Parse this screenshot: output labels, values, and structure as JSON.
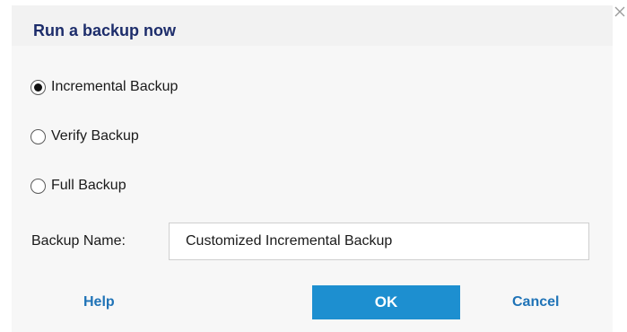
{
  "dialog": {
    "title": "Run a backup now",
    "close_icon": "close-icon"
  },
  "backup_types": [
    {
      "label": "Incremental Backup",
      "selected": true
    },
    {
      "label": "Verify Backup",
      "selected": false
    },
    {
      "label": "Full Backup",
      "selected": false
    }
  ],
  "backup_name": {
    "label": "Backup Name:",
    "value": "Customized Incremental Backup"
  },
  "buttons": {
    "help": "Help",
    "ok": "OK",
    "cancel": "Cancel"
  },
  "colors": {
    "title": "#1d2d6b",
    "link": "#1f73b7",
    "primary_button": "#1d8fd0"
  }
}
